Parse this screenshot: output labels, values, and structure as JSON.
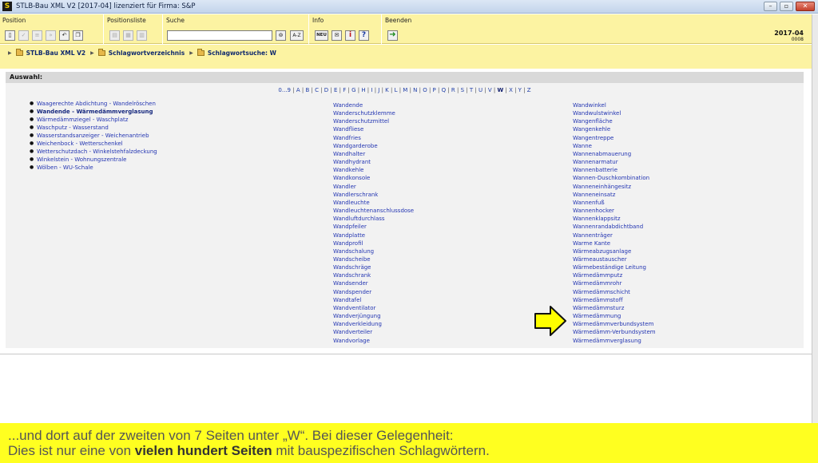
{
  "window": {
    "title": "STLB-Bau XML V2 [2017-04] lizenziert für Firma: S&P",
    "logo_letter": "S"
  },
  "toolbar": {
    "groups": {
      "position": "Position",
      "positionsliste": "Positionsliste",
      "suche": "Suche",
      "info": "Info",
      "beenden": "Beenden"
    },
    "search_value": "",
    "az_label": "A-Z",
    "neu_label": "NEU",
    "version": "2017-04",
    "version_code": "0008"
  },
  "breadcrumb": [
    "STLB-Bau XML V2",
    "Schlagwortverzeichnis",
    "Schlagwortsuche: W"
  ],
  "panel": {
    "header": "Auswahl:",
    "alphabet": [
      "0...9",
      "A",
      "B",
      "C",
      "D",
      "E",
      "F",
      "G",
      "H",
      "I",
      "J",
      "K",
      "L",
      "M",
      "N",
      "O",
      "P",
      "Q",
      "R",
      "S",
      "T",
      "U",
      "V",
      "W",
      "X",
      "Y",
      "Z"
    ],
    "current_letter": "W",
    "ranges": [
      "Waagerechte Abdichtung - Wandelröschen",
      "Wandende - Wärmedämmverglasung",
      "Wärmedämmziegel - Waschplatz",
      "Waschputz - Wasserstand",
      "Wasserstandsanzeiger - Weichenantrieb",
      "Weichenbock - Wetterschenkel",
      "Wetterschutzdach - Winkelstehfalzdeckung",
      "Winkelstein - Wohnungszentrale",
      "Wölben - WU-Schale"
    ],
    "active_range_index": 1,
    "column1": [
      "Wandende",
      "Wanderschutzklemme",
      "Wanderschutzmittel",
      "Wandfliese",
      "Wandfries",
      "Wandgarderobe",
      "Wandhalter",
      "Wandhydrant",
      "Wandkehle",
      "Wandkonsole",
      "Wandler",
      "Wandlerschrank",
      "Wandleuchte",
      "Wandleuchtenanschlussdose",
      "Wandluftdurchlass",
      "Wandpfeiler",
      "Wandplatte",
      "Wandprofil",
      "Wandschalung",
      "Wandscheibe",
      "Wandschräge",
      "Wandschrank",
      "Wandsender",
      "Wandspender",
      "Wandtafel",
      "Wandventilator",
      "Wandverjüngung",
      "Wandverkleidung",
      "Wandverteiler",
      "Wandvorlage"
    ],
    "column2": [
      "Wandwinkel",
      "Wandwulstwinkel",
      "Wangenfläche",
      "Wangenkehle",
      "Wangentreppe",
      "Wanne",
      "Wannenabmauerung",
      "Wannenarmatur",
      "Wannenbatterie",
      "Wannen-Duschkombination",
      "Wanneneinhängesitz",
      "Wanneneinsatz",
      "Wannenfuß",
      "Wannenhocker",
      "Wannenklappsitz",
      "Wannenrandabdichtband",
      "Wannenträger",
      "Warme Kante",
      "Wärmeabzugsanlage",
      "Wärmeaustauscher",
      "Wärmebeständige Leitung",
      "Wärmedämmputz",
      "Wärmedämmrohr",
      "Wärmedämmschicht",
      "Wärmedämmstoff",
      "Wärmedämmsturz",
      "Wärmedämmung",
      "Wärmedämmverbundsystem",
      "Wärmedämm-Verbundsystem",
      "Wärmedämmverglasung"
    ]
  },
  "caption": {
    "line1": "...und dort auf der zweiten von 7 Seiten unter „W“. Bei dieser Gelegenheit:",
    "line2_pre": "Dies ist nur eine von ",
    "line2_bold": "vielen hundert Seiten",
    "line2_post": " mit bauspezifischen Schlagwörtern."
  },
  "colors": {
    "toolbar_yellow": "#fcf3a2",
    "caption_yellow": "#ffff20",
    "link_blue": "#2436b2",
    "arrow_yellow": "#ffff00"
  }
}
